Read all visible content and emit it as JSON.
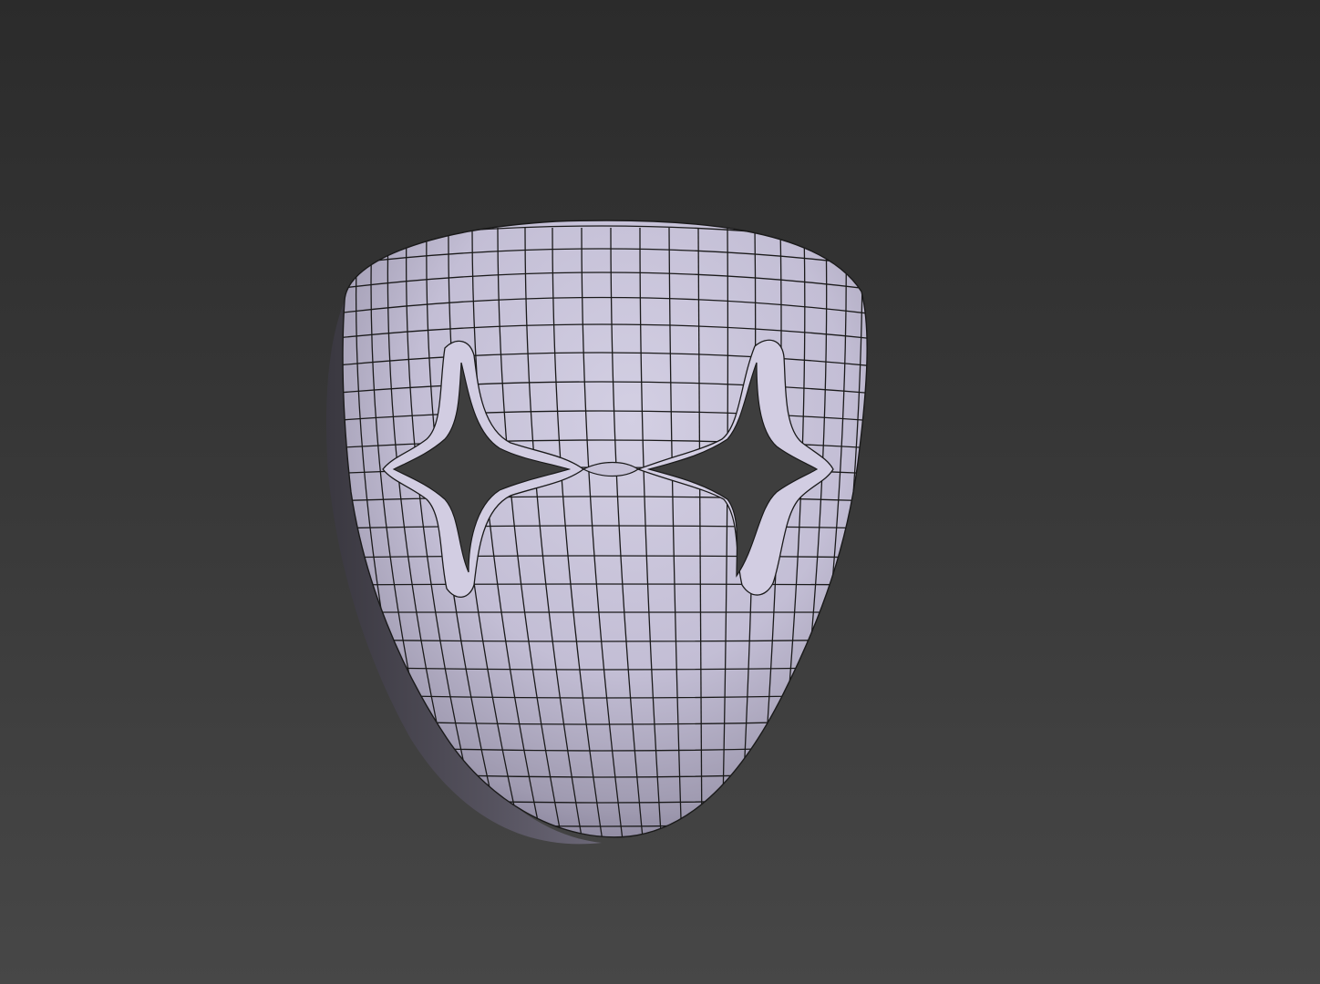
{
  "viewport": {
    "background_top": "#2b2b2b",
    "background_bottom": "#474747"
  },
  "model": {
    "object": "mask-mesh",
    "render_style": "smooth-shaded-with-wireframe",
    "surface_color": "#c9c4da",
    "wire_color": "#1a1a1a",
    "eye_holes": 2,
    "eye_hole_shape": "four-point-star"
  }
}
